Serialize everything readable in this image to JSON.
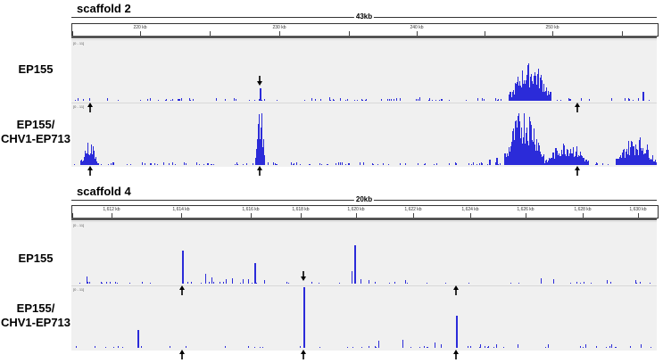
{
  "panels": [
    {
      "scaffold": "scaffold 2",
      "span": "43kb",
      "ticks": [
        "220 kb",
        "230 kb",
        "240 kb",
        "250 kb"
      ],
      "tracks": [
        {
          "label_lines": [
            "EP155"
          ],
          "range": "[0 - 11]"
        },
        {
          "label_lines": [
            "EP155/",
            "CHV1-EP713"
          ],
          "range": "[0 - 11]"
        }
      ]
    },
    {
      "scaffold": "scaffold 4",
      "span": "20kb",
      "ticks": [
        "1,612 kb",
        "1,614 kb",
        "1,616 kb",
        "1,618 kb",
        "1,620 kb",
        "1,622 kb",
        "1,624 kb",
        "1,626 kb",
        "1,628 kb",
        "1,630 kb"
      ],
      "tracks": [
        {
          "label_lines": [
            "EP155"
          ],
          "range": "[0 - 11]"
        },
        {
          "label_lines": [
            "EP155/",
            "CHV1-EP713"
          ],
          "range": "[0 - 11]"
        }
      ]
    }
  ],
  "colors": {
    "coverage": "#2b2bd9",
    "arrow": "#000000"
  }
}
